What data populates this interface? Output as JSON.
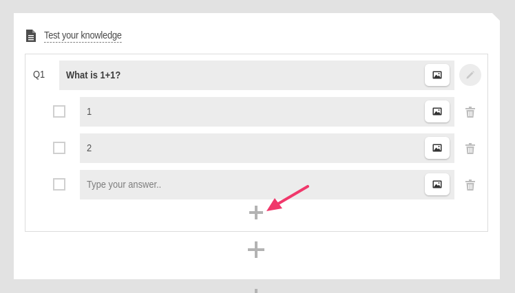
{
  "quiz": {
    "title": "Test your knowledge"
  },
  "question": {
    "number": "Q1",
    "text": "What is 1+1?"
  },
  "answers": [
    {
      "text": "1",
      "checked": false
    },
    {
      "text": "2",
      "checked": false
    }
  ],
  "new_answer": {
    "placeholder": "Type your answer.."
  },
  "icons": {
    "document": "document-icon",
    "image": "image-icon",
    "edit": "pencil-icon",
    "delete": "trash-icon",
    "add": "plus-icon",
    "annotation": "arrow-icon"
  },
  "colors": {
    "background": "#e2e2e2",
    "card": "#ffffff",
    "field": "#ececec",
    "arrow": "#f0386b"
  }
}
